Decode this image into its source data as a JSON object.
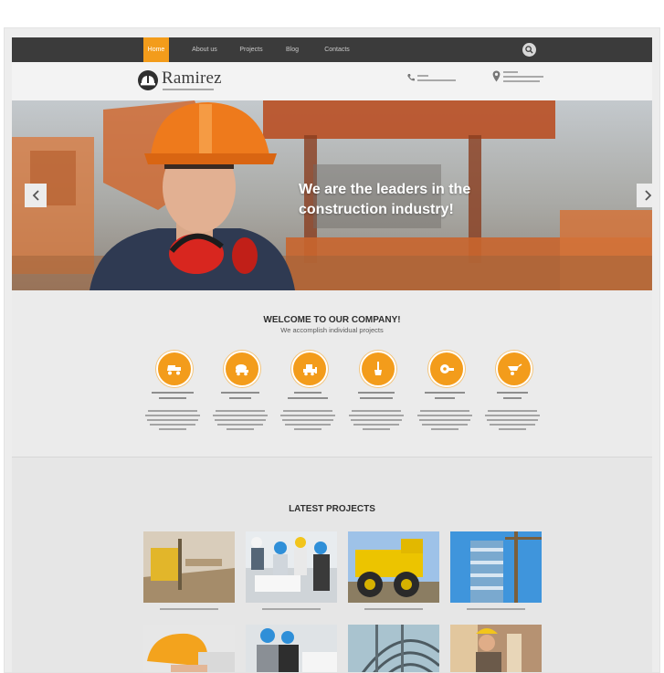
{
  "nav": {
    "items": [
      "Home",
      "About us",
      "Projects",
      "Blog",
      "Contacts"
    ],
    "active_index": 0,
    "search_icon": "search-icon"
  },
  "header": {
    "logo_text": "Ramirez",
    "logo_icon": "hard-hat-icon",
    "phone_icon": "phone-icon",
    "location_icon": "map-pin-icon"
  },
  "hero": {
    "headline_line1": "We are the leaders in the",
    "headline_line2": "construction industry!",
    "prev_icon": "chevron-left-icon",
    "next_icon": "chevron-right-icon"
  },
  "welcome": {
    "title": "WELCOME TO OUR COMPANY!",
    "subtitle": "We accomplish individual projects",
    "features": [
      {
        "icon": "dump-truck-icon"
      },
      {
        "icon": "cement-mixer-icon"
      },
      {
        "icon": "bulldozer-icon"
      },
      {
        "icon": "shovel-icon"
      },
      {
        "icon": "concrete-mixer-icon"
      },
      {
        "icon": "wheelbarrow-icon"
      }
    ]
  },
  "projects": {
    "title": "LATEST PROJECTS",
    "count": 8
  },
  "colors": {
    "accent": "#f39c1b",
    "nav_bg": "#3b3b3b",
    "text_dark": "#2f2f2f"
  }
}
